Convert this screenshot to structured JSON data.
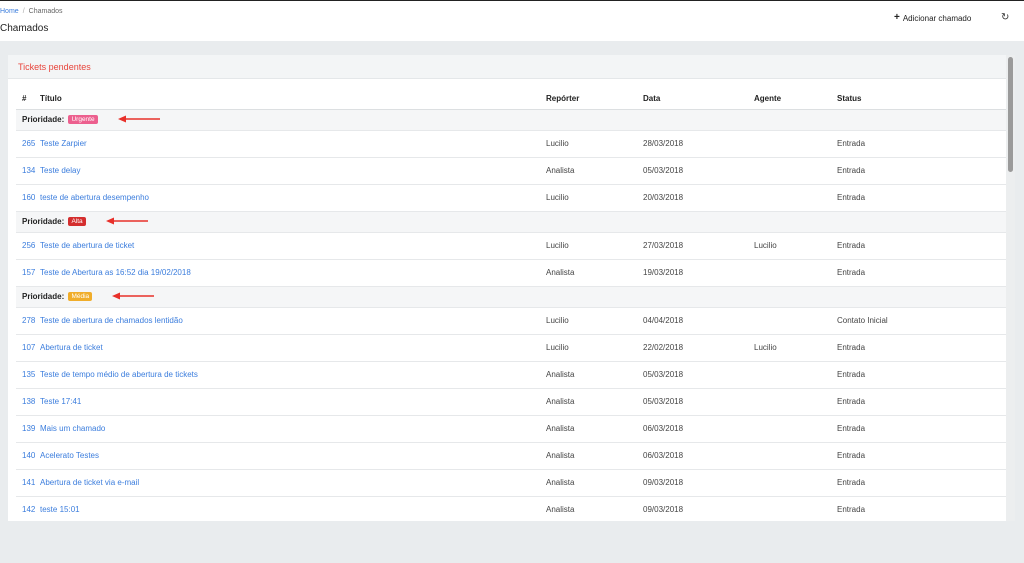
{
  "breadcrumb": {
    "home": "Home",
    "current": "Chamados"
  },
  "page_title": "Chamados",
  "actions": {
    "add_label": "Adicionar chamado",
    "add_icon": "plus-icon",
    "refresh_icon": "refresh-icon"
  },
  "card": {
    "title": "Tickets pendentes"
  },
  "table": {
    "columns": {
      "id": "#",
      "title": "Título",
      "reporter": "Repórter",
      "date": "Data",
      "agent": "Agente",
      "status": "Status"
    },
    "priority_label": "Prioridade:",
    "groups": [
      {
        "badge": "Urgente",
        "color": "#ec5f8e",
        "rows": [
          {
            "id": "265",
            "title": "Teste Zarpier",
            "reporter": "Lucilio",
            "date": "28/03/2018",
            "agent": "",
            "status": "Entrada"
          },
          {
            "id": "134",
            "title": "Teste delay",
            "reporter": "Analista",
            "date": "05/03/2018",
            "agent": "",
            "status": "Entrada"
          },
          {
            "id": "160",
            "title": "teste de abertura desempenho",
            "reporter": "Lucilio",
            "date": "20/03/2018",
            "agent": "",
            "status": "Entrada"
          }
        ]
      },
      {
        "badge": "Alta",
        "color": "#d42e2e",
        "rows": [
          {
            "id": "256",
            "title": "Teste de abertura de ticket",
            "reporter": "Lucilio",
            "date": "27/03/2018",
            "agent": "Lucilio",
            "status": "Entrada"
          },
          {
            "id": "157",
            "title": "Teste de Abertura as 16:52 dia 19/02/2018",
            "reporter": "Analista",
            "date": "19/03/2018",
            "agent": "",
            "status": "Entrada"
          }
        ]
      },
      {
        "badge": "Média",
        "color": "#f0ad2a",
        "rows": [
          {
            "id": "278",
            "title": "Teste de abertura de chamados lentidão",
            "reporter": "Lucilio",
            "date": "04/04/2018",
            "agent": "",
            "status": "Contato Inicial"
          },
          {
            "id": "107",
            "title": "Abertura de ticket",
            "reporter": "Lucilio",
            "date": "22/02/2018",
            "agent": "Lucilio",
            "status": "Entrada"
          },
          {
            "id": "135",
            "title": "Teste de tempo médio de abertura de tickets",
            "reporter": "Analista",
            "date": "05/03/2018",
            "agent": "",
            "status": "Entrada"
          },
          {
            "id": "138",
            "title": "Teste 17:41",
            "reporter": "Analista",
            "date": "05/03/2018",
            "agent": "",
            "status": "Entrada"
          },
          {
            "id": "139",
            "title": "Mais um chamado",
            "reporter": "Analista",
            "date": "06/03/2018",
            "agent": "",
            "status": "Entrada"
          },
          {
            "id": "140",
            "title": "Acelerato Testes",
            "reporter": "Analista",
            "date": "06/03/2018",
            "agent": "",
            "status": "Entrada"
          },
          {
            "id": "141",
            "title": "Abertura de ticket via e-mail",
            "reporter": "Analista",
            "date": "09/03/2018",
            "agent": "",
            "status": "Entrada"
          },
          {
            "id": "142",
            "title": "teste 15:01",
            "reporter": "Analista",
            "date": "09/03/2018",
            "agent": "",
            "status": "Entrada"
          }
        ]
      }
    ]
  },
  "colors": {
    "link": "#3b7ddd",
    "card_title": "#e8453c",
    "annotation_arrow": "#e8302a"
  }
}
